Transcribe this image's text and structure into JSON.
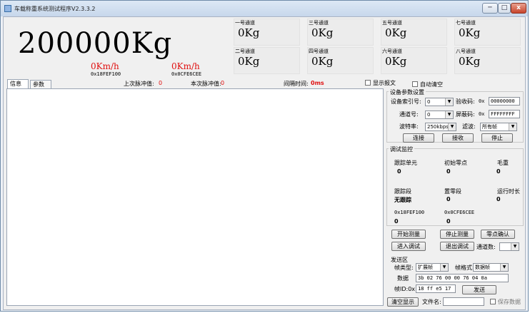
{
  "window": {
    "title": "车载称重系统测试程序V2.3.3.2",
    "min": "─",
    "max": "□",
    "close": "x"
  },
  "display": {
    "weight": "200000Kg",
    "speed1": "0Km/h",
    "speed2": "0Km/h",
    "frame1": "0x18FEF100",
    "frame2": "0x0CFE6CEE"
  },
  "channels": [
    {
      "label": "一号通道",
      "value": "0Kg"
    },
    {
      "label": "二号通道",
      "value": "0Kg"
    },
    {
      "label": "三号通道",
      "value": "0Kg"
    },
    {
      "label": "四号通道",
      "value": "0Kg"
    },
    {
      "label": "五号通道",
      "value": "0Kg"
    },
    {
      "label": "六号通道",
      "value": "0Kg"
    },
    {
      "label": "七号通道",
      "value": "0Kg"
    },
    {
      "label": "八号通道",
      "value": "0Kg"
    }
  ],
  "status": {
    "last_label": "上次脉冲值:",
    "last_value": "0",
    "cur_label": "本次脉冲值:",
    "cur_value": "0",
    "interval_label": "间隔时间:",
    "interval_value": "0ms",
    "show_frame": "显示报文",
    "auto_clear": "自动清空"
  },
  "tabs": [
    "信息",
    "参数"
  ],
  "settings": {
    "title": "设备参数设置",
    "device_index_label": "设备索引号:",
    "device_index": "0",
    "verify_label": "验收码:",
    "verify_prefix": "0x",
    "verify_value": "00000000",
    "channel_label": "通道号:",
    "channel": "0",
    "mask_label": "屏蔽码:",
    "mask_prefix": "0x",
    "mask_value": "FFFFFFFF",
    "baud_label": "波特率:",
    "baud": "250kbps",
    "filter_label": "滤波:",
    "filter": "所有帧",
    "connect": "连接",
    "receive": "接收",
    "stop": "停止"
  },
  "monitor": {
    "title": "调试监控",
    "track_unit_label": "跟踪单元",
    "track_unit": "0",
    "init_zero_label": "初始零点",
    "init_zero": "0",
    "gross_label": "毛重",
    "gross": "0",
    "track_seg_label": "跟踪段",
    "track_seg": "无跟踪",
    "zero_seg_label": "置零段",
    "zero_seg": "0",
    "runtime_label": "运行时长",
    "runtime": "0",
    "frame_a_label": "0x18FEF100",
    "frame_a": "0",
    "frame_b_label": "0x0CFE6CEE",
    "frame_b": "0"
  },
  "actions": {
    "start_weigh": "开始测量",
    "stop_weigh": "停止测量",
    "zero_confirm": "零点确认",
    "enter_debug": "进入调试",
    "exit_debug": "退出调试",
    "channel_count_label": "通道数:",
    "channel_count": ""
  },
  "send": {
    "title": "发送区",
    "frame_type_label": "帧类型:",
    "frame_type": "扩展帧",
    "frame_format_label": "帧格式:",
    "frame_format": "数据帧",
    "data_label": "数据",
    "data_value": "3b 02 76 00 00 76 04 0a",
    "frame_id_label": "帧ID:0x",
    "frame_id": "18 ff e5 17",
    "send_button": "发送"
  },
  "footer": {
    "clear_display": "清空显示",
    "filename_label": "文件名:",
    "filename": "",
    "save_data": "保存数据"
  }
}
